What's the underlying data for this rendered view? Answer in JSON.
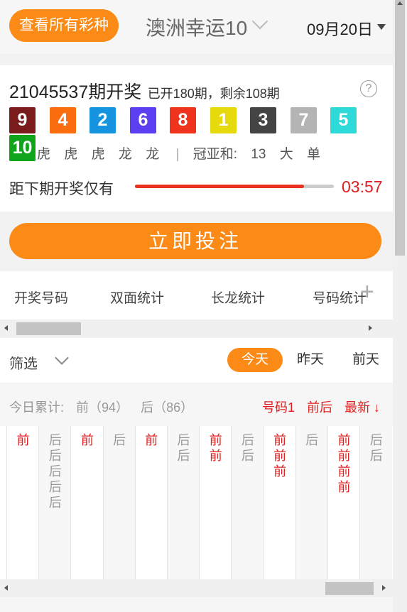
{
  "header": {
    "all_lotto_label": "查看所有彩种",
    "lottery_name": "澳洲幸运10",
    "date": "09月20日"
  },
  "draw": {
    "period_main": "21045537期开奖",
    "period_sub": "已开180期，剩余108期",
    "help": "?",
    "balls": [
      {
        "n": "9",
        "color": "#7a1c1c"
      },
      {
        "n": "4",
        "color": "#fb6e0f"
      },
      {
        "n": "2",
        "color": "#1694e0"
      },
      {
        "n": "6",
        "color": "#5b3ff0"
      },
      {
        "n": "8",
        "color": "#f0331d"
      },
      {
        "n": "1",
        "color": "#e6d90c"
      },
      {
        "n": "3",
        "color": "#444444"
      },
      {
        "n": "7",
        "color": "#b4b4b4"
      },
      {
        "n": "5",
        "color": "#2ed9d9"
      },
      {
        "n": "10",
        "color": "#10a41c"
      }
    ],
    "dragon_tiger": [
      "虎",
      "虎",
      "虎",
      "龙",
      "龙"
    ],
    "sep": "|",
    "sum_label": "冠亚和:",
    "sum_value": "13",
    "size": "大",
    "parity": "单",
    "countdown_label": "距下期开奖仅有",
    "progress": 0.85,
    "countdown_time": "03:57"
  },
  "bet_button": "立即投注",
  "tabs": [
    "开奖号码",
    "双面统计",
    "长龙统计",
    "号码统计"
  ],
  "tab_plus": "+",
  "filter": {
    "label": "筛选",
    "days": [
      {
        "label": "今天",
        "active": true
      },
      {
        "label": "昨天",
        "active": false
      },
      {
        "label": "前天",
        "active": false
      }
    ]
  },
  "summary": {
    "label": "今日累计:",
    "front": "前（94）",
    "back": "后（86）",
    "link_number": "号码1",
    "link_fb": "前后",
    "link_latest": "最新 ↓"
  },
  "grid_columns": [
    {
      "type": "front",
      "items": [
        "前"
      ]
    },
    {
      "type": "back",
      "items": [
        "后",
        "后",
        "后",
        "后",
        "后"
      ]
    },
    {
      "type": "front",
      "items": [
        "前"
      ]
    },
    {
      "type": "back",
      "items": [
        "后"
      ]
    },
    {
      "type": "front",
      "items": [
        "前"
      ]
    },
    {
      "type": "back",
      "items": [
        "后",
        "后"
      ]
    },
    {
      "type": "front",
      "items": [
        "前",
        "前"
      ]
    },
    {
      "type": "back",
      "items": [
        "后",
        "后"
      ]
    },
    {
      "type": "front",
      "items": [
        "前",
        "前",
        "前"
      ]
    },
    {
      "type": "back",
      "items": [
        "后"
      ]
    },
    {
      "type": "front",
      "items": [
        "前",
        "前",
        "前",
        "前"
      ]
    },
    {
      "type": "back",
      "items": [
        "后",
        "后"
      ]
    }
  ]
}
